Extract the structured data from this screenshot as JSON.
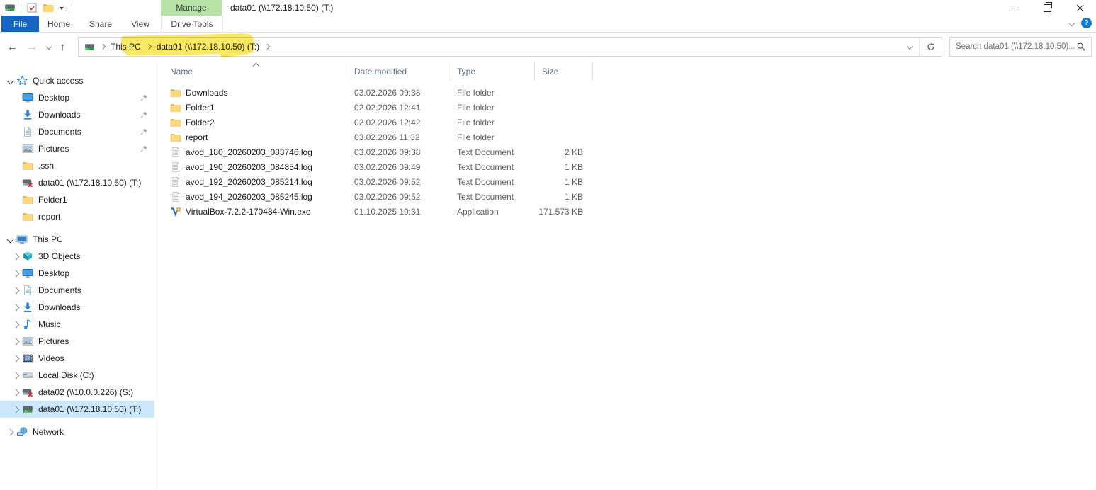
{
  "window": {
    "title": "data01 (\\\\172.18.10.50) (T:)",
    "controls": [
      "minimize",
      "restore",
      "close"
    ]
  },
  "qat": {
    "icons": [
      "drive-icon",
      "properties-check-icon",
      "folder-icon",
      "customize-caret-icon"
    ]
  },
  "ribbon": {
    "manage_label": "Manage",
    "tabs": [
      {
        "label": "File",
        "active": true
      },
      {
        "label": "Home"
      },
      {
        "label": "Share"
      },
      {
        "label": "View"
      },
      {
        "label": "Drive Tools",
        "contextual": true
      }
    ],
    "help_label": "?"
  },
  "address_bar": {
    "breadcrumb": [
      {
        "label": "This PC"
      },
      {
        "label": "data01 (\\\\172.18.10.50) (T:)",
        "highlighted": true
      }
    ],
    "search_placeholder": "Search data01 (\\\\172.18.10.50)..."
  },
  "sidebar": {
    "sections": [
      {
        "label": "Quick access",
        "icon": "star-icon",
        "expanded": true,
        "items": [
          {
            "label": "Desktop",
            "icon": "monitor-icon",
            "pinned": true
          },
          {
            "label": "Downloads",
            "icon": "download-icon",
            "pinned": true
          },
          {
            "label": "Documents",
            "icon": "document-icon",
            "pinned": true
          },
          {
            "label": "Pictures",
            "icon": "picture-icon",
            "pinned": true
          },
          {
            "label": ".ssh",
            "icon": "folder-icon"
          },
          {
            "label": "data01 (\\\\172.18.10.50) (T:)",
            "icon": "drive-disconnected-icon"
          },
          {
            "label": "Folder1",
            "icon": "folder-icon"
          },
          {
            "label": "report",
            "icon": "folder-icon"
          }
        ]
      },
      {
        "label": "This PC",
        "icon": "pc-icon",
        "expanded": true,
        "items": [
          {
            "label": "3D Objects",
            "icon": "cube-icon",
            "chevron": true
          },
          {
            "label": "Desktop",
            "icon": "monitor-icon",
            "chevron": true
          },
          {
            "label": "Documents",
            "icon": "document-icon",
            "chevron": true
          },
          {
            "label": "Downloads",
            "icon": "download-icon",
            "chevron": true
          },
          {
            "label": "Music",
            "icon": "music-icon",
            "chevron": true
          },
          {
            "label": "Pictures",
            "icon": "picture-icon",
            "chevron": true
          },
          {
            "label": "Videos",
            "icon": "video-icon",
            "chevron": true
          },
          {
            "label": "Local Disk (C:)",
            "icon": "disk-icon",
            "chevron": true
          },
          {
            "label": "data02 (\\\\10.0.0.226) (S:)",
            "icon": "drive-disconnected-icon",
            "chevron": true
          },
          {
            "label": "data01 (\\\\172.18.10.50) (T:)",
            "icon": "drive-connected-icon",
            "chevron": true,
            "selected": true
          }
        ]
      },
      {
        "label": "Network",
        "icon": "network-icon",
        "expanded": false,
        "items": []
      }
    ]
  },
  "file_list": {
    "columns": [
      "Name",
      "Date modified",
      "Type",
      "Size"
    ],
    "sort_column": "Name",
    "sort_direction": "ascending",
    "rows": [
      {
        "name": "Downloads",
        "icon": "folder-icon",
        "date": "03.02.2026 09:38",
        "type": "File folder",
        "size": ""
      },
      {
        "name": "Folder1",
        "icon": "folder-icon",
        "date": "02.02.2026 12:41",
        "type": "File folder",
        "size": ""
      },
      {
        "name": "Folder2",
        "icon": "folder-icon",
        "date": "02.02.2026 12:42",
        "type": "File folder",
        "size": ""
      },
      {
        "name": "report",
        "icon": "folder-icon",
        "date": "03.02.2026 11:32",
        "type": "File folder",
        "size": ""
      },
      {
        "name": "avod_180_20260203_083746.log",
        "icon": "textfile-icon",
        "date": "03.02.2026 09:38",
        "type": "Text Document",
        "size": "2 KB"
      },
      {
        "name": "avod_190_20260203_084854.log",
        "icon": "textfile-icon",
        "date": "03.02.2026 09:49",
        "type": "Text Document",
        "size": "1 KB"
      },
      {
        "name": "avod_192_20260203_085214.log",
        "icon": "textfile-icon",
        "date": "03.02.2026 09:52",
        "type": "Text Document",
        "size": "1 KB"
      },
      {
        "name": "avod_194_20260203_085245.log",
        "icon": "textfile-icon",
        "date": "03.02.2026 09:52",
        "type": "Text Document",
        "size": "1 KB"
      },
      {
        "name": "VirtualBox-7.2.2-170484-Win.exe",
        "icon": "vbox-icon",
        "date": "01.10.2025 19:31",
        "type": "Application",
        "size": "171.573 KB"
      }
    ]
  },
  "colors": {
    "file_tab_blue": "#1565c0",
    "manage_green": "#b6e2a6",
    "selection_blue": "#cce8ff",
    "highlight_yellow": "#f8e33c",
    "help_blue": "#0c7cd5"
  }
}
